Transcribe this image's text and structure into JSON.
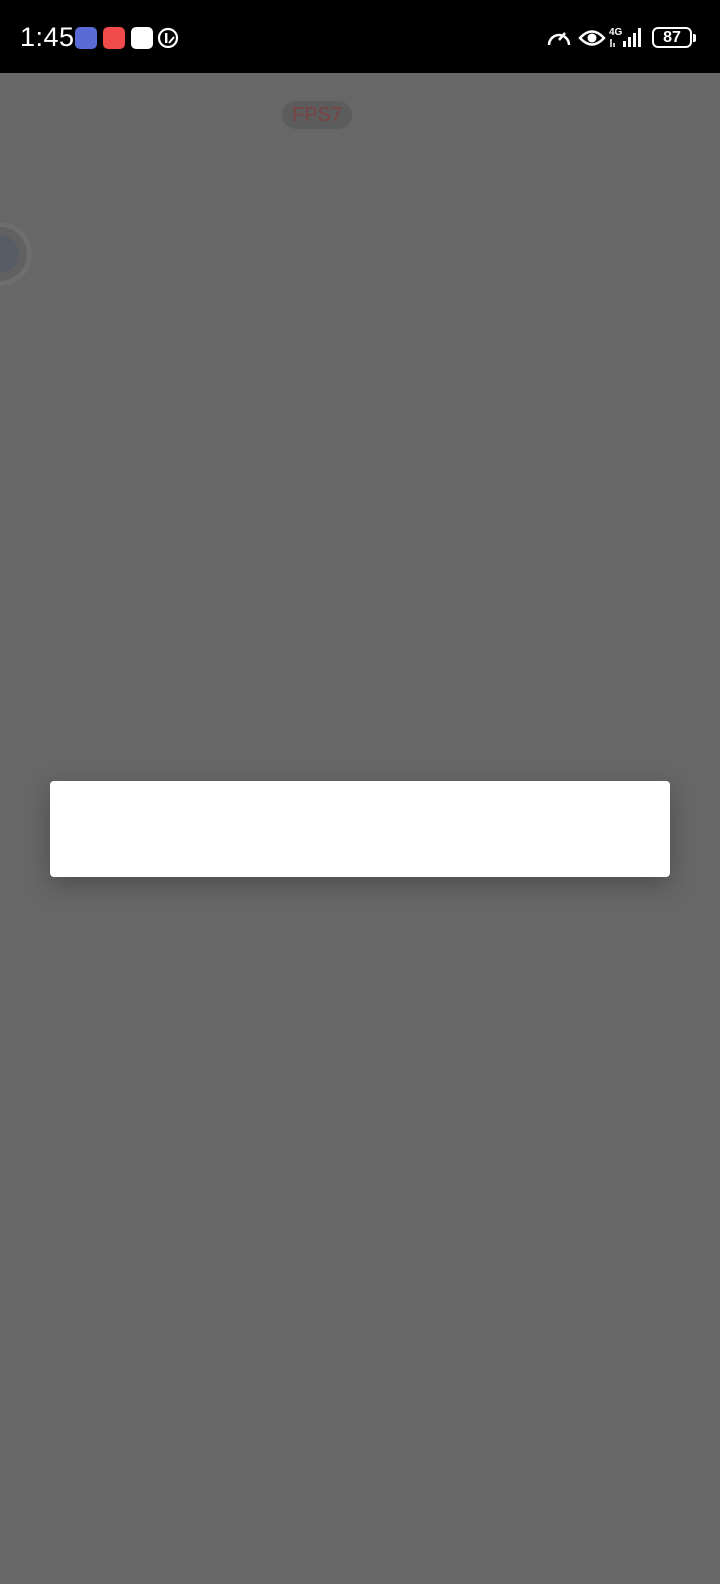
{
  "status_bar": {
    "time": "1:45",
    "battery": "87",
    "network": "4G",
    "notification_icons": [
      "calendar-app-icon",
      "shopping-app-icon",
      "message-app-icon",
      "data-saver-icon"
    ],
    "system_icons": [
      "speedometer-icon",
      "eye-icon",
      "signal-icon",
      "battery-icon"
    ]
  },
  "overlay": {
    "fps_label": "FPS7"
  },
  "colors": {
    "background": "#676767",
    "status_bar": "#000000",
    "dialog": "#ffffff"
  }
}
